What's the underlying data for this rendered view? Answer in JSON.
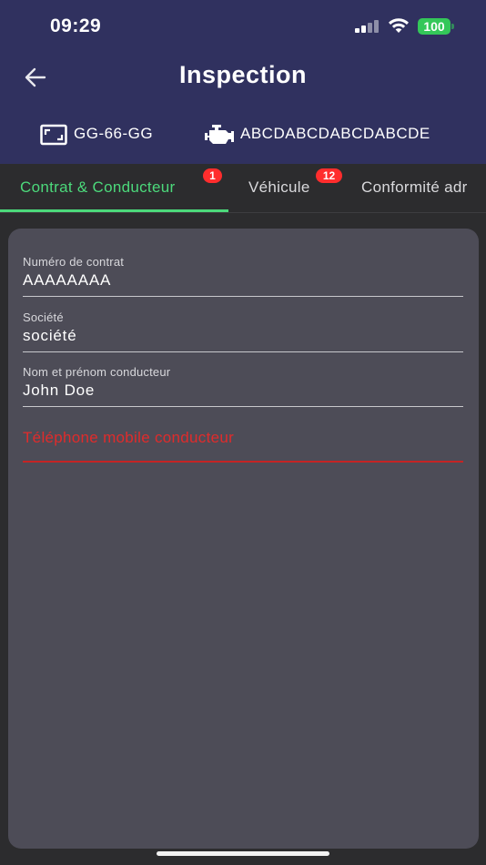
{
  "status_bar": {
    "time": "09:29",
    "battery": "100",
    "battery_color": "#34c759"
  },
  "header": {
    "title": "Inspection",
    "back_icon": "arrow-left-icon",
    "plate_icon": "license-plate-icon",
    "plate": "GG-66-GG",
    "engine_icon": "engine-icon",
    "engine_number": "ABCDABCDABCDABCDE",
    "background": "#30315f"
  },
  "tabs": [
    {
      "label": "Contrat & Conducteur",
      "badge": "1",
      "active": true
    },
    {
      "label": "Véhicule",
      "badge": "12",
      "active": false
    },
    {
      "label": "Conformité adr",
      "active": false
    }
  ],
  "accent_color": "#4cd97b",
  "error_color": "#e02b2b",
  "form": {
    "contract_number": {
      "label": "Numéro de contrat",
      "value": "AAAAAAAA"
    },
    "company": {
      "label": "Société",
      "value": "société"
    },
    "driver_name": {
      "label": "Nom et prénom conducteur",
      "value": "John Doe"
    },
    "driver_mobile": {
      "label": "Téléphone mobile conducteur",
      "value": ""
    }
  }
}
